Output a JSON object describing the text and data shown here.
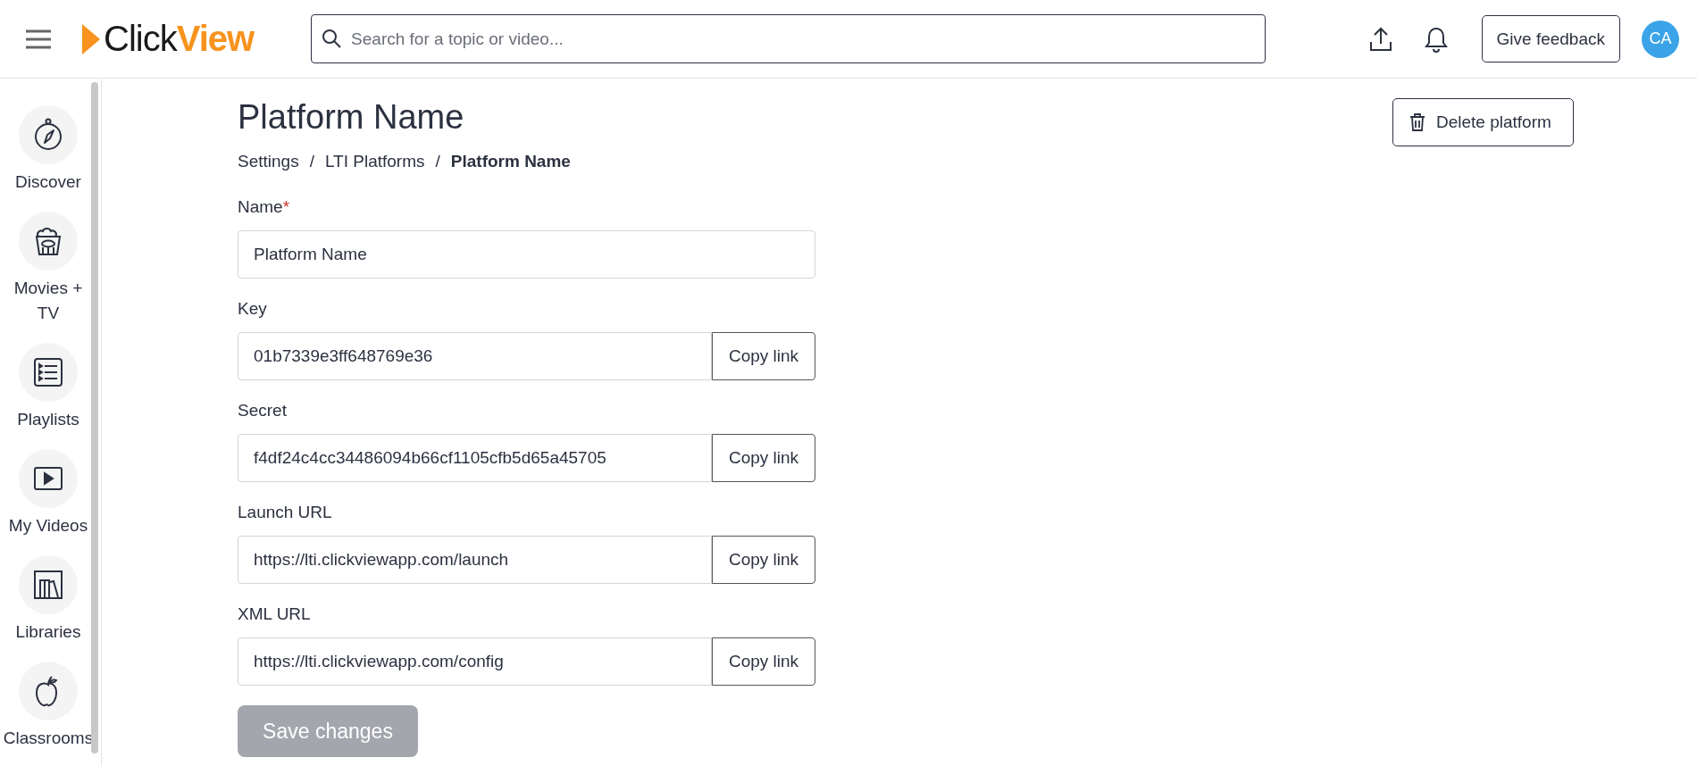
{
  "header": {
    "logo": "Click**View**",
    "search": {
      "placeholder": "Search for a topic or video..."
    },
    "feedback_button": "Give feedback",
    "avatar": "CA"
  },
  "sidebar": {
    "items": [
      {
        "label": "Discover"
      },
      {
        "label": "Movies + TV"
      },
      {
        "label": "Playlists"
      },
      {
        "label": "My Videos"
      },
      {
        "label": "Libraries"
      },
      {
        "label": "Classrooms"
      }
    ]
  },
  "page": {
    "title": "Platform Name",
    "delete_button": "Delete platform",
    "breadcrumb": [
      {
        "kind": "link",
        "label": "Settings"
      },
      {
        "kind": "separator",
        "label": "/"
      },
      {
        "kind": "link",
        "label": "LTI Platforms"
      },
      {
        "kind": "separator",
        "label": "/"
      },
      {
        "kind": "current",
        "label": "Platform Name"
      }
    ],
    "fields": [
      {
        "kind": "text",
        "label": "Name",
        "required_mark": "*",
        "value": "Platform Name"
      },
      {
        "kind": "copy",
        "label": "Key",
        "value": "01b7339e3ff648769e36",
        "button": "Copy link"
      },
      {
        "kind": "copy",
        "label": "Secret",
        "value": "f4df24c4cc34486094b66cf1105cfb5d65a45705",
        "button": "Copy link"
      },
      {
        "kind": "copy",
        "label": "Launch URL",
        "value": "https://lti.clickviewapp.com/launch",
        "button": "Copy link"
      },
      {
        "kind": "copy",
        "label": "XML URL",
        "value": "https://lti.clickviewapp.com/config",
        "button": "Copy link"
      }
    ],
    "save_button": {
      "label": "Save changes",
      "disabled": true
    }
  }
}
